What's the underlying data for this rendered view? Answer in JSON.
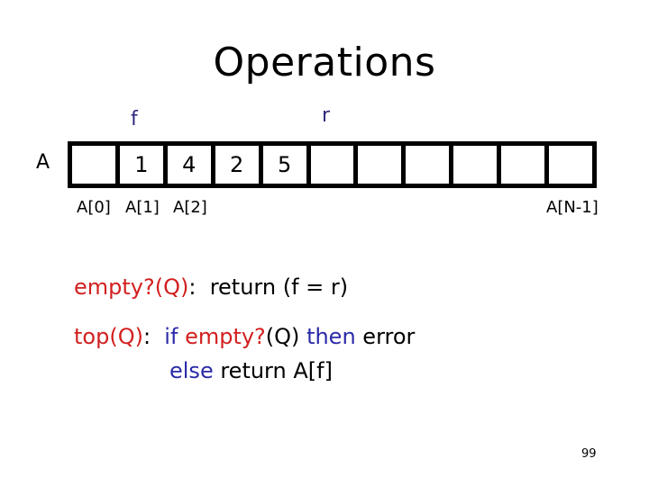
{
  "title": "Operations",
  "pointers": {
    "front": "f",
    "rear": "r"
  },
  "array": {
    "name": "A",
    "cells": [
      "",
      "1",
      "4",
      "2",
      "5",
      "",
      "",
      "",
      "",
      "",
      ""
    ],
    "index_labels": {
      "first": "A[0]",
      "second": "A[1]",
      "third": "A[2]",
      "last": "A[N-1]"
    }
  },
  "code": {
    "line1": {
      "op": "empty?(Q)",
      "colon": ":  ",
      "body": "return (f = r)"
    },
    "line2": {
      "op": "top(Q)",
      "colon": ":  ",
      "kw_if": "if",
      "sp1": " ",
      "call": "empty?",
      "arg": "(Q)",
      "sp2": " ",
      "kw_then": "then",
      "rest": " error"
    },
    "line3": {
      "kw_else": "else",
      "rest": " return A[f]"
    }
  },
  "colors": {
    "operation": "#d21f1f",
    "keyword": "#2b2aa8",
    "pointer": "#2e2a7e"
  },
  "page_number": "99"
}
